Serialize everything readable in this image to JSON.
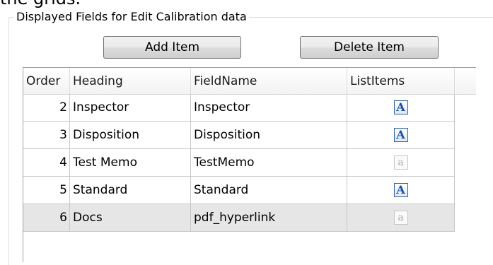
{
  "top_clipped_text": "the grids.",
  "groupbox": {
    "title": "Displayed Fields for Edit Calibration data"
  },
  "buttons": {
    "add_label": "Add Item",
    "delete_label": "Delete Item"
  },
  "grid": {
    "columns": [
      "Order",
      "Heading",
      "FieldName",
      "ListItems"
    ],
    "rows": [
      {
        "order": "2",
        "heading": "Inspector",
        "fieldname": "Inspector",
        "listitems_icon": "text-list-icon-active"
      },
      {
        "order": "3",
        "heading": "Disposition",
        "fieldname": "Disposition",
        "listitems_icon": "text-list-icon-active"
      },
      {
        "order": "4",
        "heading": "Test Memo",
        "fieldname": "TestMemo",
        "listitems_icon": "text-list-icon-inactive"
      },
      {
        "order": "5",
        "heading": "Standard",
        "fieldname": "Standard",
        "listitems_icon": "text-list-icon-active"
      },
      {
        "order": "6",
        "heading": "Docs",
        "fieldname": "pdf_hyperlink",
        "listitems_icon": "text-list-icon-inactive",
        "selected": true
      }
    ],
    "icon_glyphs": {
      "active": "A",
      "inactive": "a"
    }
  },
  "colors": {
    "icon_active_border": "#2f5fb0",
    "icon_active_text": "#1a4ea8",
    "selected_row_bg": "#e6e6e6"
  }
}
